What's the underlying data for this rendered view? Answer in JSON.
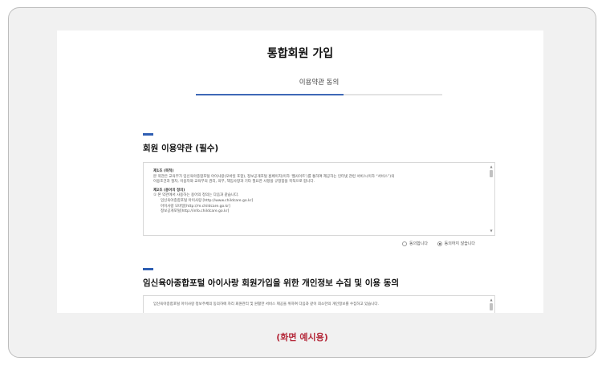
{
  "page": {
    "title": "통합회원 가입",
    "step_label": "이용약관 동의",
    "step_progress": 0.6
  },
  "section1": {
    "title": "회원 이용약관 (필수)",
    "lines": [
      {
        "text": "제1조 (목적)",
        "style": "head"
      },
      {
        "text": "본 약관은 교육부가 임신육아종합포털 아이사랑(모바일 포함), 정보공개포털 홈페이지(이하 ‘웹사이트’)를 통하여 제공하는 인터넷 관련 서비스(이하 “서비스”)의",
        "style": "normal"
      },
      {
        "text": "이용조건과 절차, 이용자와 교육부의 권리, 의무, 책임사항과 기타 필요한 사항을 규정함을 목적으로 합니다.",
        "style": "normal"
      },
      {
        "text": "",
        "style": "gap"
      },
      {
        "text": "제2조 (용어의 정의)",
        "style": "head"
      },
      {
        "text": "① 본 약관에서 사용하는 용어의 정의는 다음과 같습니다.",
        "style": "normal"
      },
      {
        "text": "임신육아종합포털 아이사랑 [http://www.childcare.go.kr]",
        "style": "indent"
      },
      {
        "text": "아이사랑 모바일[http://m.childcare.go.kr]",
        "style": "indent"
      },
      {
        "text": "정보공개포털[http://info.childcare.go.kr]",
        "style": "indent"
      }
    ],
    "agree_label": "동의합니다",
    "disagree_label": "동의하지 않습니다",
    "selected": "disagree"
  },
  "section2": {
    "title": "임신육아종합포털 아이사랑 회원가입을 위한 개인정보 수집 및 이용 동의",
    "lines": [
      {
        "text": "임신육아종합포털 아이사랑 정보주체의 동의하에 자리 회원관리 및 원활한 서비스 제공을 위하여 다음과 같이 최소한의 개인정보를 수집하고 있습니다.",
        "style": "normal"
      }
    ]
  },
  "caption": "(화면 예시용)"
}
